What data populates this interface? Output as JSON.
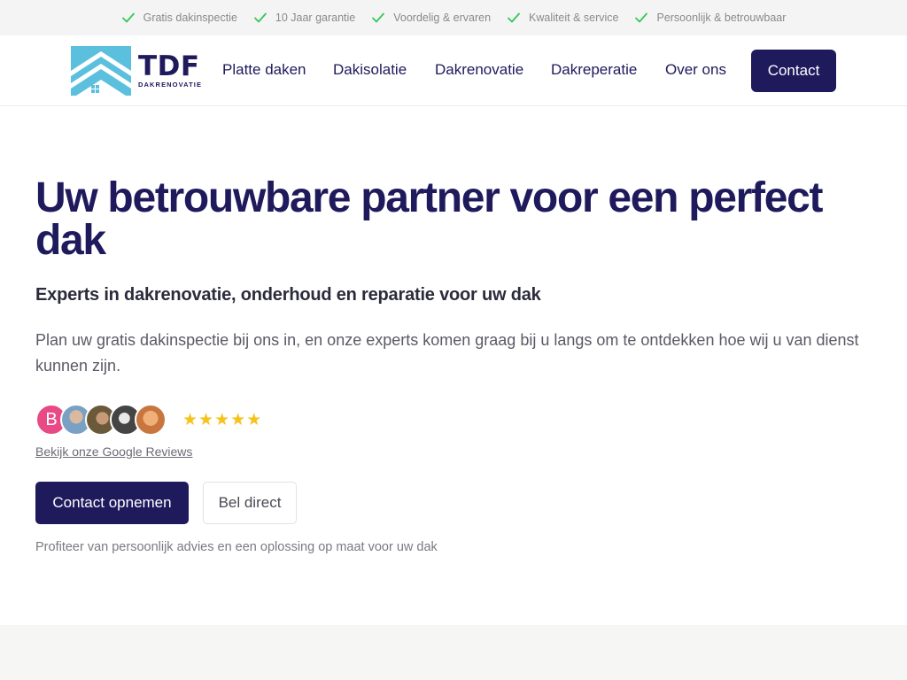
{
  "topbar": {
    "items": [
      {
        "label": "Gratis dakinspectie",
        "icon": "check-icon"
      },
      {
        "label": "10 Jaar garantie",
        "icon": "check-icon"
      },
      {
        "label": "Voordelig & ervaren",
        "icon": "check-icon"
      },
      {
        "label": "Kwaliteit & service",
        "icon": "check-icon"
      },
      {
        "label": "Persoonlijk & betrouwbaar",
        "icon": "check-icon"
      }
    ],
    "check_color": "#34c759"
  },
  "header": {
    "logo": {
      "name": "TDF",
      "tagline": "DAKRENOVATIE"
    },
    "nav": [
      {
        "label": "Platte daken"
      },
      {
        "label": "Dakisolatie"
      },
      {
        "label": "Dakrenovatie"
      },
      {
        "label": "Dakreperatie"
      },
      {
        "label": "Over ons"
      }
    ],
    "contact_label": "Contact"
  },
  "hero": {
    "title": "Uw betrouwbare partner voor een perfect dak",
    "subtitle": "Experts in dakrenovatie, onderhoud en reparatie voor uw dak",
    "lead": "Plan uw gratis dakinspectie bij ons in, en onze experts komen graag bij u langs om te ontdekken hoe wij u van dienst kunnen zijn.",
    "reviews": {
      "first_avatar_letter": "B",
      "rating": 5,
      "link_label": "Bekijk onze Google Reviews"
    },
    "primary_cta": "Contact opnemen",
    "secondary_cta": "Bel direct",
    "note": "Profiteer van persoonlijk advies en een oplossing op maat voor uw dak"
  },
  "colors": {
    "brand": "#1e1a5c",
    "accent_light": "#5bc0de",
    "star": "#f6c21b"
  }
}
